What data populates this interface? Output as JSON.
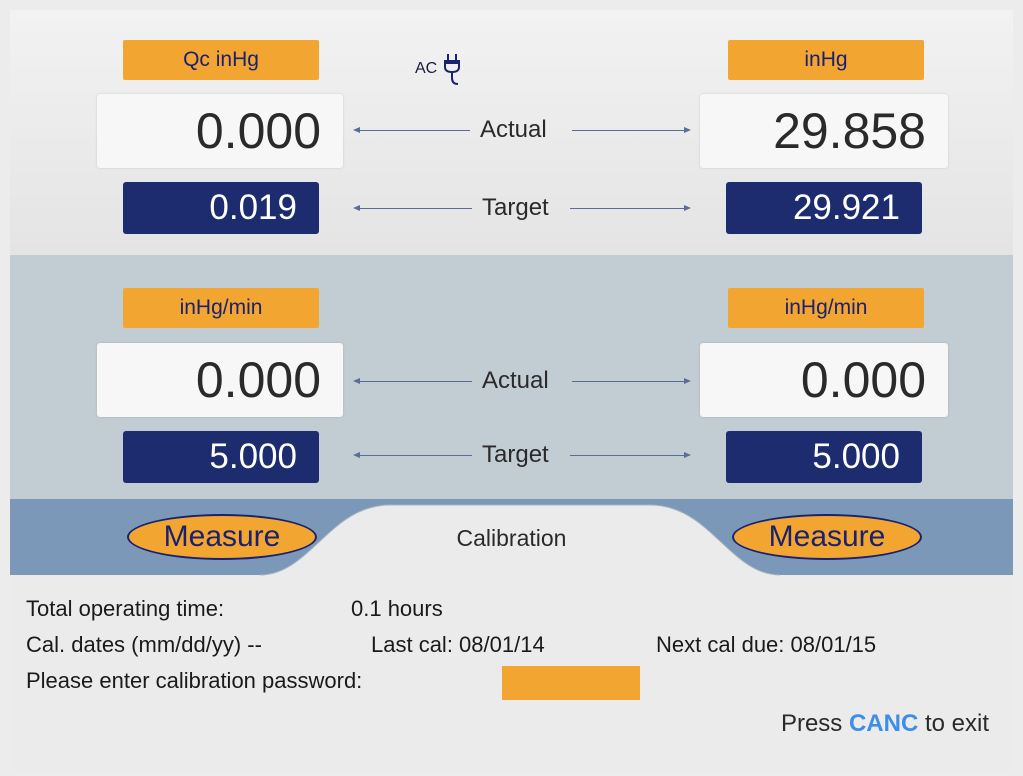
{
  "top": {
    "left_unit": "Qc inHg",
    "right_unit": "inHg",
    "ac_label": "AC",
    "ac_icon": "plug-icon",
    "left_actual": "0.000",
    "right_actual": "29.858",
    "left_target": "0.019",
    "right_target": "29.921",
    "actual_label": "Actual",
    "target_label": "Target"
  },
  "middle": {
    "left_unit": "inHg/min",
    "right_unit": "inHg/min",
    "left_actual": "0.000",
    "right_actual": "0.000",
    "left_target": "5.000",
    "right_target": "5.000",
    "actual_label": "Actual",
    "target_label": "Target"
  },
  "tabs": {
    "left_button": "Measure",
    "center_tab": "Calibration",
    "right_button": "Measure"
  },
  "info": {
    "operating_time_label": "Total operating time:",
    "operating_time_value": "0.1 hours",
    "cal_dates_label": "Cal. dates (mm/dd/yy) --",
    "last_cal": "Last cal: 08/01/14",
    "next_cal": "Next cal due: 08/01/15",
    "password_prompt": "Please enter calibration password:",
    "password_value": "",
    "press_prefix": "Press",
    "press_key": "CANC",
    "press_suffix": "to exit"
  },
  "colors": {
    "accent_orange": "#f3a531",
    "target_navy": "#1c2c6e",
    "mid_panel": "#c2ccd3",
    "tab_bar": "#7b98b8",
    "canc_blue": "#3d8ee6"
  }
}
